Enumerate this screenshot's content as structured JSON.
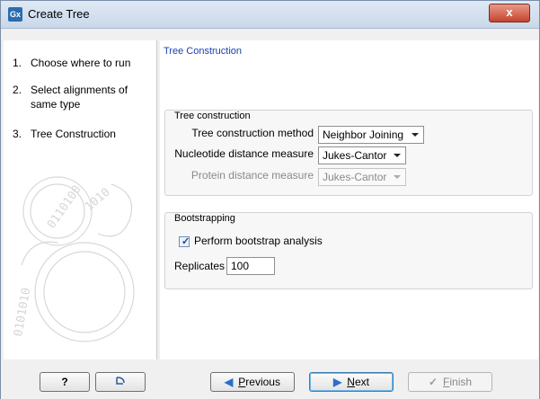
{
  "window": {
    "title": "Create Tree",
    "app_icon_text": "Gx",
    "close_glyph": "x"
  },
  "steps": [
    {
      "num": "1.",
      "label": "Choose where to run"
    },
    {
      "num": "2.",
      "label": "Select alignments of same type"
    },
    {
      "num": "3.",
      "label": "Tree Construction"
    }
  ],
  "main": {
    "section_title": "Tree Construction",
    "tree_group": {
      "title": "Tree construction",
      "method_label": "Tree construction method",
      "method_value": "Neighbor Joining",
      "nucleotide_label": "Nucleotide distance measure",
      "nucleotide_value": "Jukes-Cantor",
      "protein_label": "Protein distance measure",
      "protein_value": "Jukes-Cantor"
    },
    "bootstrap_group": {
      "title": "Bootstrapping",
      "perform_label": "Perform bootstrap analysis",
      "perform_checked": true,
      "replicates_label": "Replicates",
      "replicates_value": "100"
    }
  },
  "buttons": {
    "help": "?",
    "reset_icon": "reset-icon",
    "previous_first": "P",
    "previous_rest": "revious",
    "next_first": "N",
    "next_rest": "ext",
    "finish_first": "F",
    "finish_rest": "inish"
  },
  "colors": {
    "section_title": "#1c3fb0",
    "titlebar": "#c9d8ea",
    "close": "#c5432e"
  }
}
